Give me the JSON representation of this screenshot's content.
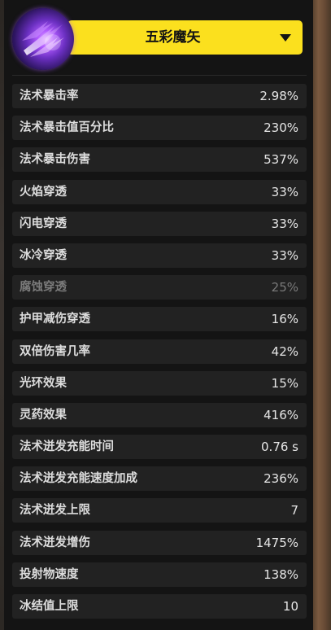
{
  "skill": {
    "name": "五彩魔矢",
    "icon": "arcane-bolts-icon"
  },
  "colors": {
    "selector_bg": "#fbe01e",
    "row_bg": "#222222",
    "panel_bg": "#141414",
    "text": "#dcdcdc",
    "dim_text": "#7a7a7a"
  },
  "stats": [
    {
      "label": "法术暴击率",
      "value": "2.98%"
    },
    {
      "label": "法术暴击值百分比",
      "value": "230%"
    },
    {
      "label": "法术暴击伤害",
      "value": "537%"
    },
    {
      "label": "火焰穿透",
      "value": "33%"
    },
    {
      "label": "闪电穿透",
      "value": "33%"
    },
    {
      "label": "冰冷穿透",
      "value": "33%"
    },
    {
      "label": "腐蚀穿透",
      "value": "25%",
      "dim": true
    },
    {
      "label": "护甲减伤穿透",
      "value": "16%"
    },
    {
      "label": "双倍伤害几率",
      "value": "42%"
    },
    {
      "label": "光环效果",
      "value": "15%"
    },
    {
      "label": "灵药效果",
      "value": "416%"
    },
    {
      "label": "法术迸发充能时间",
      "value": "0.76 s"
    },
    {
      "label": "法术迸发充能速度加成",
      "value": "236%"
    },
    {
      "label": "法术迸发上限",
      "value": "7"
    },
    {
      "label": "法术迸发增伤",
      "value": "1475%"
    },
    {
      "label": "投射物速度",
      "value": "138%"
    },
    {
      "label": "冰结值上限",
      "value": "10"
    }
  ]
}
